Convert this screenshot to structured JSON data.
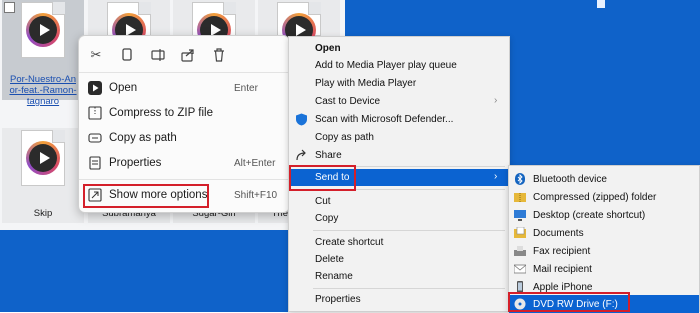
{
  "desktop": {
    "background": "#0f62c9"
  },
  "files": [
    {
      "label": "Por-Nuestro-Amor-feat.-Ramon-tagnaro",
      "selected": true,
      "visible_label": [
        "Por-Nuestro-An",
        "or-feat.-Ramon-",
        "tagnaro"
      ]
    },
    {
      "label": "Skip"
    },
    {
      "label": "Subramanya"
    },
    {
      "label": "Sugar-Girl"
    },
    {
      "label": "The"
    }
  ],
  "context_menu": {
    "quick_actions": [
      "cut-icon",
      "copy-icon",
      "rename-icon",
      "share-icon",
      "delete-icon"
    ],
    "items": [
      {
        "label": "Open",
        "shortcut": "Enter",
        "icon": "media-player-icon"
      },
      {
        "label": "Compress to ZIP file",
        "shortcut": "",
        "icon": "zip-icon"
      },
      {
        "label": "Copy as path",
        "shortcut": "",
        "icon": "path-icon"
      },
      {
        "label": "Properties",
        "shortcut": "Alt+Enter",
        "icon": "properties-icon"
      },
      {
        "label": "Show more options",
        "shortcut": "Shift+F10",
        "icon": "more-options-icon"
      }
    ]
  },
  "classic_menu": {
    "items": [
      {
        "label": "Open",
        "bold": true
      },
      {
        "label": "Add to Media Player play queue"
      },
      {
        "label": "Play with Media Player"
      },
      {
        "label": "Cast to Device",
        "submenu": true
      },
      {
        "label": "Scan with Microsoft Defender..."
      },
      {
        "label": "Copy as path"
      },
      {
        "label": "Share"
      },
      {
        "label": "Send to",
        "submenu": true,
        "highlighted": true
      },
      {
        "label": "Cut"
      },
      {
        "label": "Copy"
      },
      {
        "label": "Create shortcut"
      },
      {
        "label": "Delete"
      },
      {
        "label": "Rename"
      },
      {
        "label": "Properties"
      }
    ]
  },
  "send_to_menu": {
    "items": [
      {
        "label": "Bluetooth device",
        "icon": "bluetooth-icon"
      },
      {
        "label": "Compressed (zipped) folder",
        "icon": "zip-folder-icon"
      },
      {
        "label": "Desktop (create shortcut)",
        "icon": "desktop-icon"
      },
      {
        "label": "Documents",
        "icon": "documents-icon"
      },
      {
        "label": "Fax recipient",
        "icon": "fax-icon"
      },
      {
        "label": "Mail recipient",
        "icon": "mail-icon"
      },
      {
        "label": "Apple iPhone",
        "icon": "phone-icon"
      },
      {
        "label": "DVD RW Drive (F:)",
        "icon": "dvd-drive-icon",
        "highlighted": true
      }
    ]
  },
  "colors": {
    "highlight": "#0b63d1",
    "annotation_red": "#d41f2a"
  }
}
